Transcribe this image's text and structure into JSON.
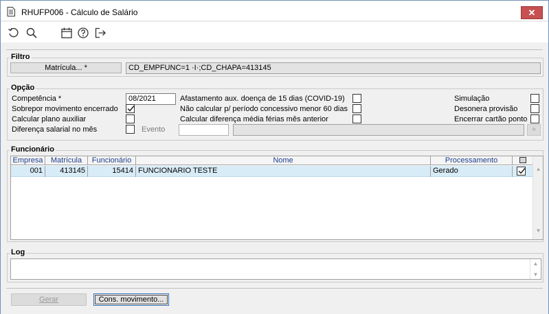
{
  "window": {
    "title": "RHUFP006 - Cálculo de Salário",
    "close_label": "✕"
  },
  "toolbar": {
    "icons": [
      "undo-icon",
      "search-icon",
      "calendar-icon",
      "help-icon",
      "exit-icon"
    ]
  },
  "filtro": {
    "title": "Filtro",
    "matricula_button": "Matrícula... *",
    "filter_value": "CD_EMPFUNC=1 ·I·;CD_CHAPA=413145"
  },
  "opcao": {
    "title": "Opção",
    "competencia_label": "Competência *",
    "competencia_value": "08/2021",
    "sobrepor_label": "Sobrepor movimento encerrado",
    "sobrepor_checked": true,
    "calcular_plano_label": "Calcular plano auxiliar",
    "diferenca_salarial_label": "Diferença salarial no mês",
    "evento_label": "Evento",
    "evento_value": "",
    "evento_desc": "",
    "evento_lookup": "»",
    "afastamento_label": "Afastamento aux. doença de 15 dias (COVID-19)",
    "nao_calcular_label": "Não calcular p/ período concessivo menor 60 dias",
    "calcular_diferenca_label": "Calcular diferença média férias mês anterior",
    "simulacao_label": "Simulação",
    "desonera_label": "Desonera provisão",
    "encerrar_label": "Encerrar cartão ponto"
  },
  "funcionario": {
    "title": "Funcionário",
    "columns": [
      "Empresa",
      "Matrícula",
      "Funcionário",
      "Nome",
      "Processamento"
    ],
    "rows": [
      {
        "empresa": "001",
        "matricula": "413145",
        "funcionario": "15414",
        "nome": "FUNCIONARIO TESTE",
        "processamento": "Gerado",
        "checked": true
      }
    ]
  },
  "log": {
    "title": "Log",
    "text": ""
  },
  "actions": {
    "gerar": "Gerar",
    "cons_movimento": "Cons. movimento..."
  }
}
